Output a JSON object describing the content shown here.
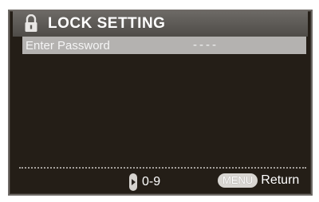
{
  "menu": {
    "title": "LOCK SETTING",
    "title_icon": "lock-icon"
  },
  "password_row": {
    "label": "Enter Password",
    "value": "----"
  },
  "footer": {
    "digits_icon": "numpad-icon",
    "digits_label": "0-9",
    "menu_icon_label": "MENU",
    "return_label": "Return"
  },
  "colors": {
    "screen_background": "#241e17",
    "title_bar": "#5d5a56",
    "selected_row": "#b4b2b0",
    "text": "#ffffff"
  }
}
